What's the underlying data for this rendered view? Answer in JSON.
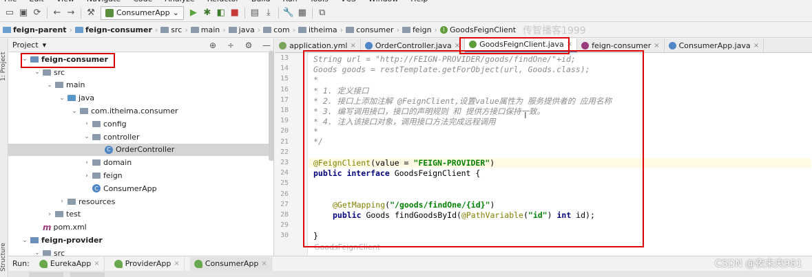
{
  "menubar": {
    "items": [
      "File",
      "Edit",
      "View",
      "Navigate",
      "Code",
      "Analyze",
      "Refactor",
      "Build",
      "Run",
      "Tools",
      "VCS",
      "Window",
      "Help"
    ]
  },
  "toolbar": {
    "run_config": "ConsumerApp"
  },
  "breadcrumb": {
    "items": [
      "feign-parent",
      "feign-consumer",
      "src",
      "main",
      "java",
      "com",
      "itheima",
      "consumer",
      "feign",
      "GoodsFeignClient"
    ],
    "watermark": "传智播客1999"
  },
  "left_strip": {
    "project_label": "1: Project",
    "structure_label": "Structure"
  },
  "project_panel": {
    "title": "Project",
    "tree": [
      {
        "label": "feign-consumer",
        "depth": 0,
        "type": "module",
        "expanded": true,
        "bold": true
      },
      {
        "label": "src",
        "depth": 1,
        "type": "folder",
        "expanded": true
      },
      {
        "label": "main",
        "depth": 2,
        "type": "folder",
        "expanded": true
      },
      {
        "label": "java",
        "depth": 3,
        "type": "src",
        "expanded": true
      },
      {
        "label": "com.itheima.consumer",
        "depth": 4,
        "type": "folder",
        "expanded": true
      },
      {
        "label": "config",
        "depth": 5,
        "type": "folder",
        "expanded": false
      },
      {
        "label": "controller",
        "depth": 5,
        "type": "folder",
        "expanded": true
      },
      {
        "label": "OrderController",
        "depth": 6,
        "type": "class",
        "selected": true
      },
      {
        "label": "domain",
        "depth": 5,
        "type": "folder",
        "expanded": false
      },
      {
        "label": "feign",
        "depth": 5,
        "type": "folder",
        "expanded": false
      },
      {
        "label": "ConsumerApp",
        "depth": 5,
        "type": "class"
      },
      {
        "label": "resources",
        "depth": 3,
        "type": "folder",
        "expanded": false
      },
      {
        "label": "test",
        "depth": 2,
        "type": "folder",
        "expanded": false
      },
      {
        "label": "pom.xml",
        "depth": 1,
        "type": "maven"
      },
      {
        "label": "feign-provider",
        "depth": 0,
        "type": "module",
        "expanded": true,
        "bold": true
      },
      {
        "label": "src",
        "depth": 1,
        "type": "folder",
        "expanded": true
      }
    ]
  },
  "editor_tabs": [
    {
      "label": "application.yml",
      "color": "#7aa35b",
      "active": false
    },
    {
      "label": "OrderController.java",
      "color": "#4f87c6",
      "active": false
    },
    {
      "label": "GoodsFeignClient.java",
      "color": "#5f9e3a",
      "active": true
    },
    {
      "label": "feign-consumer",
      "color": "#9a3a7a",
      "active": false
    },
    {
      "label": "ConsumerApp.java",
      "color": "#4f87c6",
      "active": false
    }
  ],
  "editor": {
    "line_numbers": [
      "13",
      "14",
      "15",
      "16",
      "17",
      "18",
      "19",
      "20",
      "21",
      "22",
      "23",
      "24",
      "25",
      "26",
      "27",
      "28",
      "29",
      "30"
    ],
    "lines": {
      "l13": "String url = \"http://FEIGN-PROVIDER/goods/findOne/\"+id;",
      "l14": "Goods goods = restTemplate.getForObject(url, Goods.class);",
      "l15": "*",
      "l16": "* 1. 定义接口",
      "l17": "* 2. 接口上添加注解 @FeignClient,设置value属性为 服务提供者的 应用名称",
      "l18": "* 3. 编写调用接口，接口的声明规则 和 提供方接口保持一致。",
      "l19": "* 4. 注入该接口对象，调用接口方法完成远程调用",
      "l20": "*",
      "l21": "*/",
      "l23_ann": "@FeignClient",
      "l23_mid": "(value = ",
      "l23_str": "\"FEIGN-PROVIDER\"",
      "l23_end": ")",
      "l24_kw": "public interface",
      "l24_rest": " GoodsFeignClient {",
      "l27_ann": "@GetMapping",
      "l27_mid": "(",
      "l27_str": "\"/goods/findOne/{id}\"",
      "l27_end": ")",
      "l28_kw": "public",
      "l28_a": " Goods findGoodsById(",
      "l28_ann": "@PathVariable",
      "l28_b": "(",
      "l28_str": "\"id\"",
      "l28_c": ") ",
      "l28_kw2": "int",
      "l28_d": " id);",
      "l30": "}"
    },
    "footer": "GoodsFeignClient"
  },
  "run_bar": {
    "label": "Run:",
    "tabs": [
      "EurekaApp",
      "ProviderApp",
      "ConsumerApp"
    ]
  },
  "watermark": "CSDN @夜未央981"
}
